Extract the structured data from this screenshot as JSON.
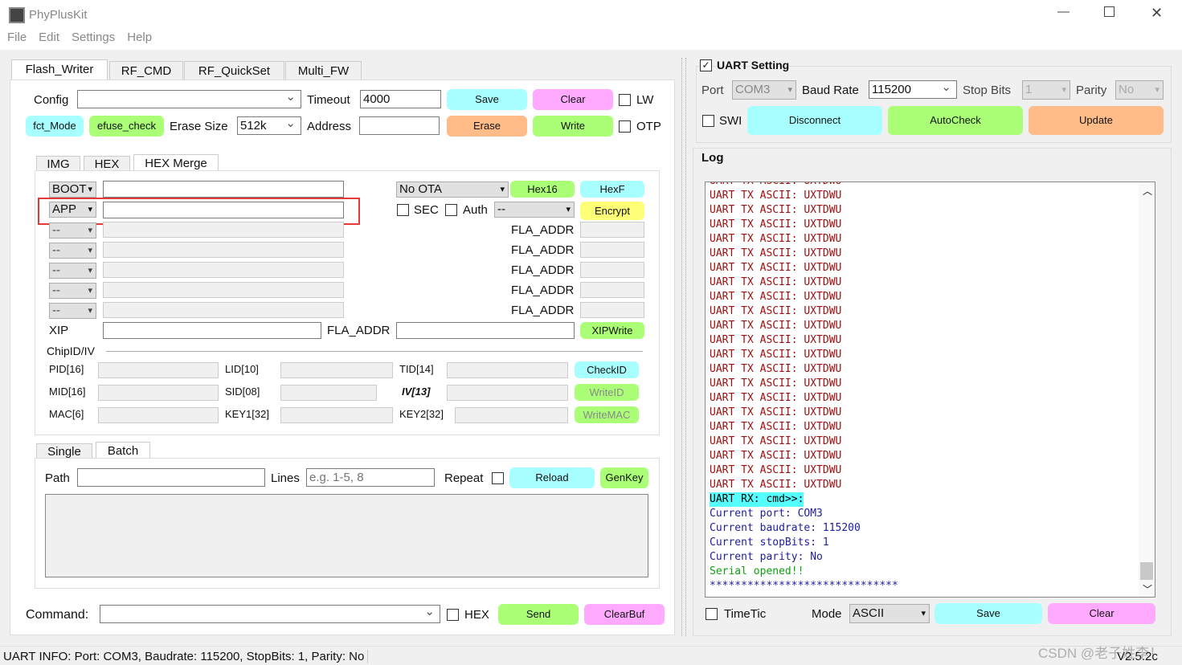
{
  "app": {
    "title": "PhyPlusKit"
  },
  "menu": [
    "File",
    "Edit",
    "Settings",
    "Help"
  ],
  "tabs": [
    "Flash_Writer",
    "RF_CMD",
    "RF_QuickSet",
    "Multi_FW"
  ],
  "config": {
    "config_label": "Config",
    "config_value": "",
    "timeout_label": "Timeout",
    "timeout_value": "4000",
    "save": "Save",
    "clear": "Clear",
    "lw": "LW",
    "fct_mode": "fct_Mode",
    "efuse_check": "efuse_check",
    "erase_size_label": "Erase Size",
    "erase_size_value": "512k",
    "address_label": "Address",
    "address_value": "",
    "erase": "Erase",
    "write": "Write",
    "otp": "OTP"
  },
  "subtabs": [
    "IMG",
    "HEX",
    "HEX Merge"
  ],
  "merge": {
    "boot": "BOOT",
    "app": "APP",
    "ota": "No OTA",
    "hex16": "Hex16",
    "hexf": "HexF",
    "sec": "SEC",
    "auth": "Auth",
    "auth_value": "--",
    "encrypt": "Encrypt",
    "slot_value": "--",
    "fla_addr": "FLA_ADDR",
    "xip": "XIP",
    "xipwrite": "XIPWrite"
  },
  "chip": {
    "title": "ChipID/IV",
    "pid": "PID[16]",
    "lid": "LID[10]",
    "tid": "TID[14]",
    "checkid": "CheckID",
    "mid": "MID[16]",
    "sid": "SID[08]",
    "iv": "IV[13]",
    "writeid": "WriteID",
    "mac": "MAC[6]",
    "key1": "KEY1[32]",
    "key2": "KEY2[32]",
    "writemac": "WriteMAC"
  },
  "batch": {
    "tabs": [
      "Single",
      "Batch"
    ],
    "path": "Path",
    "lines": "Lines",
    "lines_placeholder": "e.g. 1-5, 8",
    "repeat": "Repeat",
    "reload": "Reload",
    "genkey": "GenKey"
  },
  "command": {
    "label": "Command:",
    "hex": "HEX",
    "send": "Send",
    "clearbuf": "ClearBuf"
  },
  "status": "UART INFO: Port: COM3, Baudrate: 115200, StopBits: 1, Parity: No",
  "uart": {
    "title": "UART Setting",
    "port_label": "Port",
    "port": "COM3",
    "baud_label": "Baud Rate",
    "baud": "115200",
    "stop_label": "Stop Bits",
    "stop": "1",
    "parity_label": "Parity",
    "parity": "No",
    "swi": "SWI",
    "disconnect": "Disconnect",
    "autocheck": "AutoCheck",
    "update": "Update"
  },
  "log": {
    "title": "Log",
    "tx_line": "UART TX ASCII: UXTDWU",
    "rx_line": "UART RX: cmd>>:",
    "info": [
      "Current port: COM3",
      "Current baudrate: 115200",
      "Current stopBits: 1",
      "Current parity: No"
    ],
    "opened": "Serial opened!!",
    "stars": "******************************",
    "timetic": "TimeTic",
    "mode_label": "Mode",
    "mode": "ASCII",
    "save": "Save",
    "clear": "Clear"
  },
  "version": "V2.5.2c",
  "watermark": "CSDN @老子姓李！",
  "colors": {
    "tx": "#a01010",
    "info": "#2020a0",
    "ok": "#10a010",
    "rx_bg": "#55ffff",
    "highlight": "#e53935"
  }
}
